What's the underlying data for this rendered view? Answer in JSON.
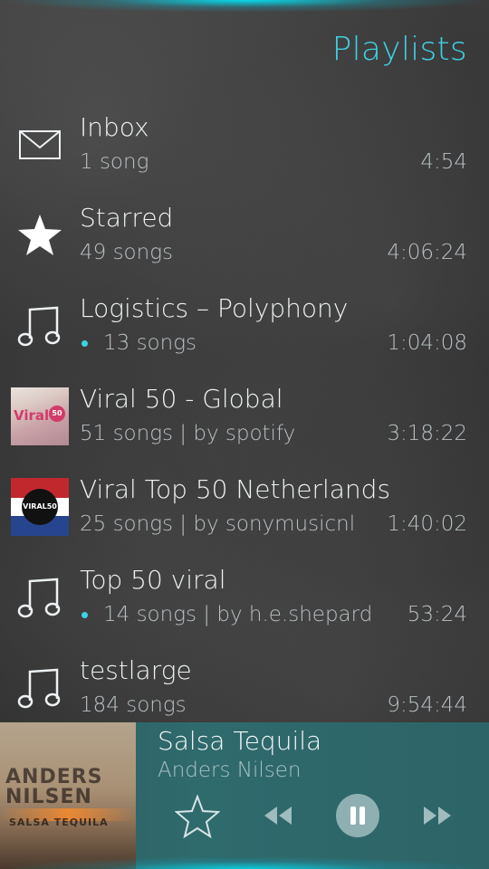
{
  "header": {
    "title": "Playlists"
  },
  "colors": {
    "accent": "#3fd1e6",
    "player_bg": "#2f6a6d"
  },
  "playlists": [
    {
      "name": "Inbox",
      "subtitle": "1 song",
      "duration": "4:54",
      "icon": "envelope-icon",
      "offline": false
    },
    {
      "name": "Starred",
      "subtitle": "49 songs",
      "duration": "4:06:24",
      "icon": "star-icon",
      "offline": false
    },
    {
      "name": "Logistics – Polyphony",
      "subtitle": "13 songs",
      "duration": "1:04:08",
      "icon": "music-note-icon",
      "offline": true
    },
    {
      "name": "Viral 50 - Global",
      "subtitle": "51 songs | by spotify",
      "duration": "3:18:22",
      "icon": "cover-art",
      "offline": false,
      "cover_text": "Viral",
      "cover_badge": "50"
    },
    {
      "name": "Viral Top 50 Netherlands",
      "subtitle": "25 songs | by sonymusicnl",
      "duration": "1:40:02",
      "icon": "cover-art",
      "offline": false,
      "cover_text": "VIRAL50"
    },
    {
      "name": "Top 50 viral",
      "subtitle": "14 songs | by h.e.shepard",
      "duration": "53:24",
      "icon": "music-note-icon",
      "offline": true
    },
    {
      "name": "testlarge",
      "subtitle": "184 songs",
      "duration": "9:54:44",
      "icon": "music-note-icon",
      "offline": false
    }
  ],
  "now_playing": {
    "title": "Salsa Tequila",
    "artist": "Anders Nilsen",
    "art_artist": "ANDERS NILSEN",
    "art_title": "SALSA TEQUILA",
    "controls": [
      "star-icon",
      "rewind-icon",
      "pause-icon",
      "fast-forward-icon"
    ]
  }
}
